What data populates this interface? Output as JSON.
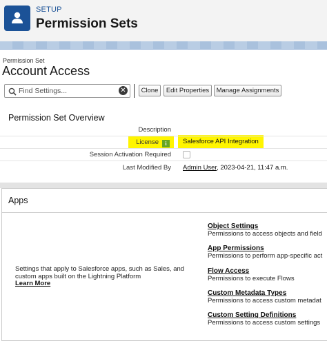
{
  "header": {
    "setup_label": "SETUP",
    "title": "Permission Sets",
    "icon": "user-icon"
  },
  "record": {
    "type_label": "Permission Set",
    "name": "Account Access"
  },
  "toolbar": {
    "search_placeholder": "Find Settings...",
    "clear_symbol": "✕",
    "clone_label": "Clone",
    "edit_label": "Edit Properties",
    "manage_label": "Manage Assignments"
  },
  "overview": {
    "title": "Permission Set Overview",
    "description_label": "Description",
    "description_value": "",
    "license_label": "License",
    "license_value": "Salesforce API Integration",
    "info_symbol": "i",
    "session_label": "Session Activation Required",
    "session_checked": false,
    "modified_label": "Last Modified By",
    "modified_user": "Admin User",
    "modified_date": ", 2023-04-21, 11:47 a.m.",
    "highlight_color": "#fff500"
  },
  "apps": {
    "title": "Apps",
    "description": "Settings that apply to Salesforce apps, such as Sales, and custom apps built on the Lightning Platform",
    "learn_more": "Learn More",
    "items": [
      {
        "title": "Object Settings",
        "desc": "Permissions to access objects and field"
      },
      {
        "title": "App Permissions",
        "desc": "Permissions to perform app-specific act"
      },
      {
        "title": "Flow Access",
        "desc": "Permissions to execute Flows"
      },
      {
        "title": "Custom Metadata Types",
        "desc": "Permissions to access custom metadat"
      },
      {
        "title": "Custom Setting Definitions",
        "desc": "Permissions to access custom settings"
      }
    ]
  }
}
